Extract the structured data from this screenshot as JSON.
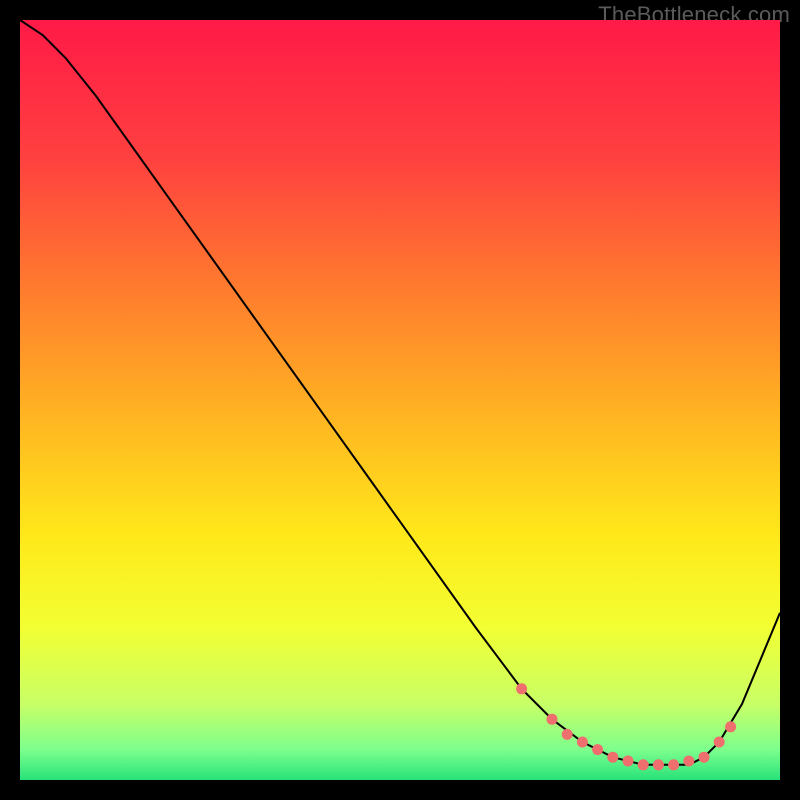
{
  "watermark": "TheBottleneck.com",
  "chart_data": {
    "type": "line",
    "title": "",
    "xlabel": "",
    "ylabel": "",
    "xlim": [
      0,
      100
    ],
    "ylim": [
      0,
      100
    ],
    "grid": false,
    "legend": false,
    "background_gradient": {
      "stops": [
        {
          "pos": 0.0,
          "color": "#ff1a47"
        },
        {
          "pos": 0.18,
          "color": "#ff4040"
        },
        {
          "pos": 0.35,
          "color": "#ff7a2e"
        },
        {
          "pos": 0.52,
          "color": "#ffb422"
        },
        {
          "pos": 0.68,
          "color": "#ffe91a"
        },
        {
          "pos": 0.8,
          "color": "#f2ff33"
        },
        {
          "pos": 0.9,
          "color": "#c8ff66"
        },
        {
          "pos": 0.96,
          "color": "#7dff8d"
        },
        {
          "pos": 1.0,
          "color": "#28e27a"
        }
      ]
    },
    "series": [
      {
        "name": "curve",
        "stroke": "#000000",
        "x": [
          0,
          3,
          6,
          10,
          20,
          30,
          40,
          50,
          60,
          66,
          70,
          74,
          78,
          82,
          85,
          88,
          90,
          92,
          95,
          100
        ],
        "y": [
          100,
          98,
          95,
          90,
          76,
          62,
          48,
          34,
          20,
          12,
          8,
          5,
          3,
          2,
          2,
          2,
          3,
          5,
          10,
          22
        ]
      }
    ],
    "markers": {
      "color": "#ef6e6e",
      "points": [
        {
          "x": 66,
          "y": 12
        },
        {
          "x": 70,
          "y": 8
        },
        {
          "x": 72,
          "y": 6
        },
        {
          "x": 74,
          "y": 5
        },
        {
          "x": 76,
          "y": 4
        },
        {
          "x": 78,
          "y": 3
        },
        {
          "x": 80,
          "y": 2.5
        },
        {
          "x": 82,
          "y": 2
        },
        {
          "x": 84,
          "y": 2
        },
        {
          "x": 86,
          "y": 2
        },
        {
          "x": 88,
          "y": 2.5
        },
        {
          "x": 90,
          "y": 3
        },
        {
          "x": 92,
          "y": 5
        },
        {
          "x": 93.5,
          "y": 7
        }
      ]
    }
  }
}
